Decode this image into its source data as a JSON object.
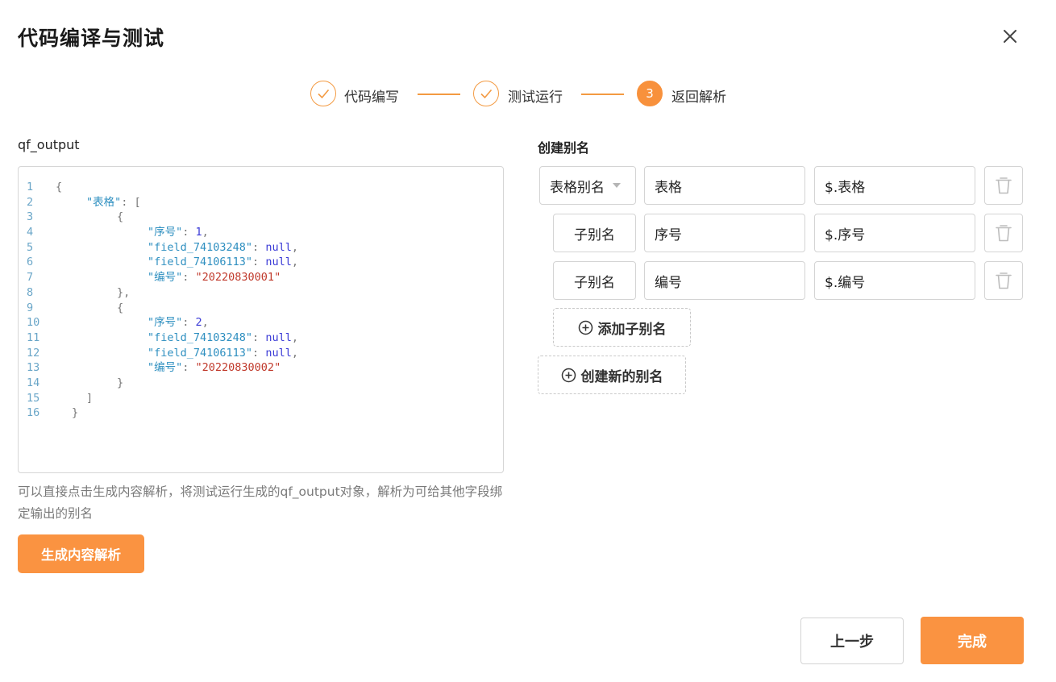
{
  "dialog": {
    "title": "代码编译与测试",
    "close_icon": "close-icon"
  },
  "steps": [
    {
      "label": "代码编写",
      "state": "done"
    },
    {
      "label": "测试运行",
      "state": "done"
    },
    {
      "label": "返回解析",
      "state": "active",
      "number": "3"
    }
  ],
  "left": {
    "field_label": "qf_output",
    "code_lines": [
      {
        "no": "1"
      },
      {
        "no": "2"
      },
      {
        "no": "3"
      },
      {
        "no": "4"
      },
      {
        "no": "5"
      },
      {
        "no": "6"
      },
      {
        "no": "7"
      },
      {
        "no": "8"
      },
      {
        "no": "9"
      },
      {
        "no": "10"
      },
      {
        "no": "11"
      },
      {
        "no": "12"
      },
      {
        "no": "13"
      },
      {
        "no": "14"
      },
      {
        "no": "15"
      },
      {
        "no": "16"
      }
    ],
    "code": {
      "l1": "{",
      "k_table": "\"表格\"",
      "l2_tail": ": [",
      "brace_open": "{",
      "k_seq": "\"序号\"",
      "colon": ": ",
      "v1": "1",
      "comma": ",",
      "k_f1": "\"field_74103248\"",
      "k_f2": "\"field_74106113\"",
      "null": "null",
      "k_no": "\"编号\"",
      "v_no1": "\"20220830001\"",
      "brace_close_comma": "},",
      "v2": "2",
      "v_no2": "\"20220830002\"",
      "brace_close": "}",
      "bracket_close": "]",
      "l16": "}"
    },
    "hint": "可以直接点击生成内容解析，将测试运行生成的qf_output对象，解析为可给其他字段绑定输出的别名",
    "generate_button": "生成内容解析"
  },
  "right": {
    "field_label": "创建别名",
    "rows": [
      {
        "type_label": "表格别名",
        "name": "表格",
        "path": "$.表格"
      },
      {
        "type_label": "子别名",
        "name": "序号",
        "path": "$.序号"
      },
      {
        "type_label": "子别名",
        "name": "编号",
        "path": "$.编号"
      }
    ],
    "add_child_button": "添加子别名",
    "add_new_button": "创建新的别名"
  },
  "footer": {
    "prev_button": "上一步",
    "done_button": "完成"
  },
  "colors": {
    "accent": "#fa9341",
    "code_key": "#2e8fc0",
    "code_number": "#3a3ad6",
    "code_string": "#c0392b"
  }
}
